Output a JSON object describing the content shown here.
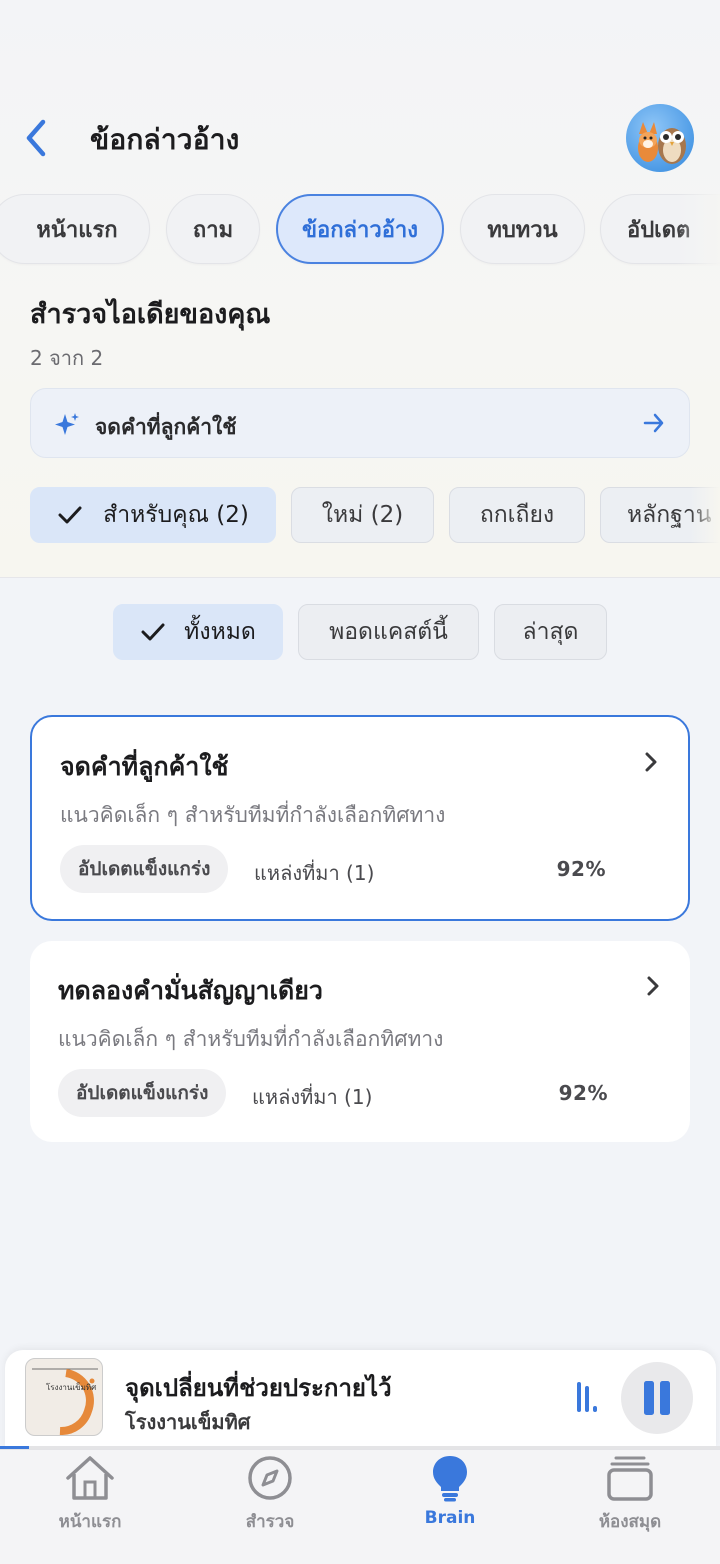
{
  "header": {
    "title": "ข้อกล่าวอ้าง"
  },
  "tabs": [
    {
      "label": "หน้าแรก"
    },
    {
      "label": "ถาม"
    },
    {
      "label": "ข้อกล่าวอ้าง",
      "active": true
    },
    {
      "label": "ทบทวน"
    },
    {
      "label": "อัปเดต"
    }
  ],
  "section": {
    "title": "สำรวจไอเดียของคุณ",
    "subtitle": "2 จาก 2"
  },
  "prompt": {
    "label": "จดคำที่ลูกค้าใช้"
  },
  "chips": [
    {
      "label": "สำหรับคุณ (2)",
      "active": true
    },
    {
      "label": "ใหม่ (2)"
    },
    {
      "label": "ถกเถียง"
    },
    {
      "label": "หลักฐาน"
    }
  ],
  "filters": [
    {
      "label": "ทั้งหมด",
      "active": true
    },
    {
      "label": "พอดแคสต์นี้"
    },
    {
      "label": "ล่าสุด"
    }
  ],
  "cards": [
    {
      "title": "จดคำที่ลูกค้าใช้",
      "description": "แนวคิดเล็ก ๆ สำหรับทีมที่กำลังเลือกทิศทาง",
      "badge": "อัปเดตแข็งแกร่ง",
      "sources": "แหล่งที่มา (1)",
      "percent": "92%",
      "selected": true
    },
    {
      "title": "ทดลองคำมั่นสัญญาเดียว",
      "description": "แนวคิดเล็ก ๆ สำหรับทีมที่กำลังเลือกทิศทาง",
      "badge": "อัปเดตแข็งแกร่ง",
      "sources": "แหล่งที่มา (1)",
      "percent": "92%",
      "selected": false
    }
  ],
  "player": {
    "title": "จุดเปลี่ยนที่ช่วยประกายไว้",
    "subtitle": "โรงงานเข็มทิศ",
    "art_text": "โรงงานเข็มทิศ",
    "progress": 0.04
  },
  "nav": [
    {
      "label": "หน้าแรก",
      "icon": "home-icon"
    },
    {
      "label": "สำรวจ",
      "icon": "compass-icon"
    },
    {
      "label": "Brain",
      "icon": "lightbulb-icon",
      "active": true
    },
    {
      "label": "ห้องสมุด",
      "icon": "library-icon"
    }
  ],
  "colors": {
    "accent": "#3a78dc",
    "active_chip": "#dae6f8"
  }
}
